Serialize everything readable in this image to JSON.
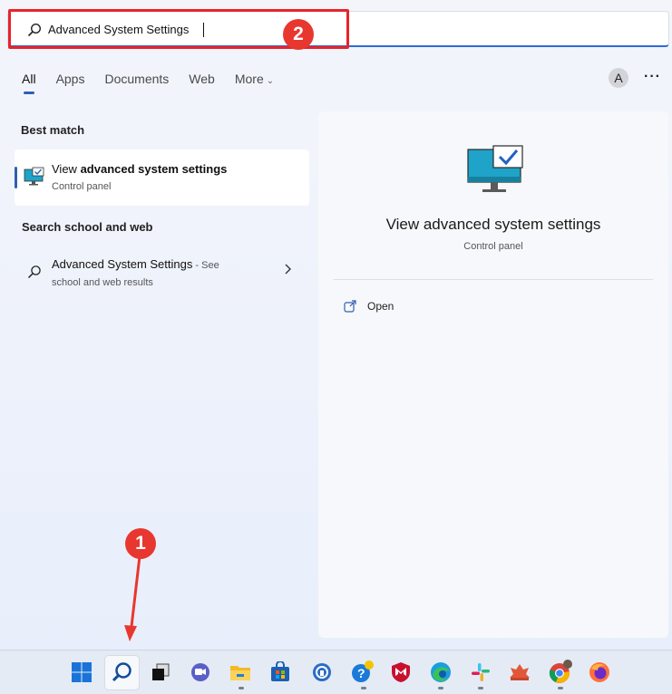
{
  "search": {
    "value": "Advanced System Settings",
    "icon": "search-icon"
  },
  "annotations": {
    "step1": "1",
    "step2": "2",
    "color": "#e8372f"
  },
  "tabs": [
    {
      "label": "All",
      "active": true
    },
    {
      "label": "Apps"
    },
    {
      "label": "Documents"
    },
    {
      "label": "Web"
    },
    {
      "label": "More"
    }
  ],
  "account": {
    "avatar_letter": "A",
    "more_icon": "ellipsis-icon"
  },
  "best_match": {
    "heading": "Best match",
    "title_prefix": "View ",
    "title_bold": "advanced system settings",
    "subtitle": "Control panel",
    "icon": "monitor-check-icon"
  },
  "web": {
    "heading": "Search school and web",
    "title": "Advanced System Settings",
    "see": " - See",
    "subtitle": "school and web results",
    "icon": "search-icon"
  },
  "detail": {
    "title": "View advanced system settings",
    "subtitle": "Control panel",
    "open_label": "Open",
    "open_icon": "open-external-icon"
  },
  "taskbar": {
    "apps": [
      "windows-start-icon",
      "search-icon",
      "task-view-icon",
      "teams-chat-icon",
      "file-explorer-icon",
      "microsoft-store-icon",
      "app-icon",
      "tips-icon",
      "mcafee-icon",
      "edge-icon",
      "slack-icon",
      "app-icon",
      "chrome-icon",
      "firefox-icon"
    ]
  },
  "colors": {
    "accent": "#2f5fb3",
    "highlight": "#e8232a"
  }
}
